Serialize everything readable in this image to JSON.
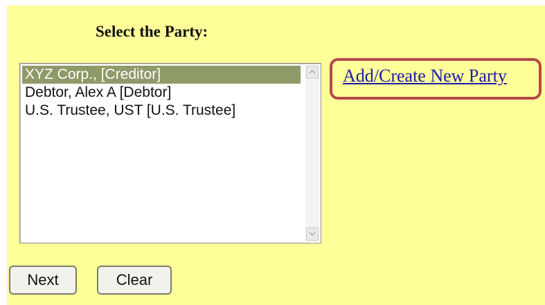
{
  "heading": "Select the Party:",
  "party_list": {
    "items": [
      {
        "label": "XYZ Corp., [Creditor]",
        "selected": true
      },
      {
        "label": "Debtor, Alex A [Debtor]",
        "selected": false
      },
      {
        "label": "U.S. Trustee, UST [U.S. Trustee]",
        "selected": false
      }
    ]
  },
  "add_party_link": "Add/Create New Party",
  "buttons": {
    "next": "Next",
    "clear": "Clear"
  },
  "colors": {
    "background": "#ffff99",
    "selected_row": "#8f9a69",
    "link": "#1a1aad",
    "highlight_border": "#b34a4a"
  }
}
